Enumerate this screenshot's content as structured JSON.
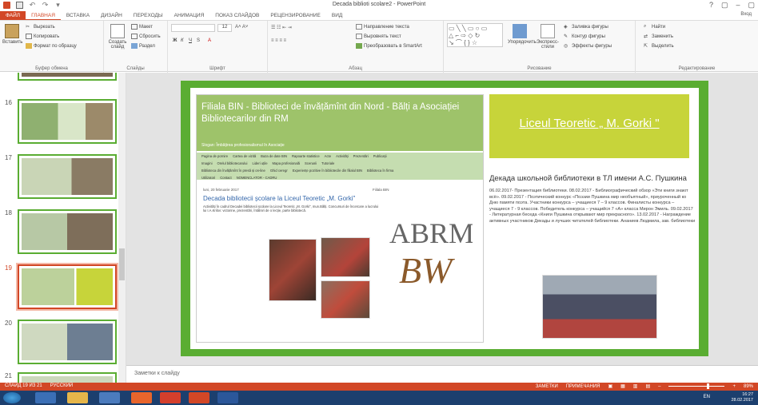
{
  "window": {
    "title": "Decada biblioti scolare2 - PowerPoint",
    "controls": [
      "?",
      "▢",
      "–",
      "▢"
    ]
  },
  "tabs": [
    {
      "label": "ФАЙЛ",
      "kind": "file"
    },
    {
      "label": "ГЛАВНАЯ",
      "kind": "active"
    },
    {
      "label": "ВСТАВКА",
      "kind": ""
    },
    {
      "label": "ДИЗАЙН",
      "kind": ""
    },
    {
      "label": "ПЕРЕХОДЫ",
      "kind": ""
    },
    {
      "label": "АНИМАЦИЯ",
      "kind": ""
    },
    {
      "label": "ПОКАЗ СЛАЙДОВ",
      "kind": ""
    },
    {
      "label": "РЕЦЕНЗИРОВАНИЕ",
      "kind": ""
    },
    {
      "label": "ВИД",
      "kind": ""
    }
  ],
  "signin": "Вход",
  "ribbon": {
    "clipboard": {
      "paste": "Вставить",
      "cut": "Вырезать",
      "copy": "Копировать",
      "format_painter": "Формат по образцу",
      "label": "Буфер обмена"
    },
    "slides": {
      "new_slide": "Создать слайд",
      "layout": "Макет",
      "reset": "Сбросить",
      "section": "Раздел",
      "label": "Слайды"
    },
    "font": {
      "size": "12",
      "bold": "Ж",
      "italic": "К",
      "underline": "Ч",
      "strike": "S",
      "label": "Шрифт"
    },
    "paragraph": {
      "text_direction": "Направление текста",
      "align_text": "Выровнять текст",
      "smartart": "Преобразовать в SmartArt",
      "label": "Абзац"
    },
    "drawing": {
      "arrange": "Упорядочить",
      "quick_styles": "Экспресс-стили",
      "fill": "Заливка фигуры",
      "outline": "Контур фигуры",
      "effects": "Эффекты фигуры",
      "label": "Рисование"
    },
    "editing": {
      "find": "Найти",
      "replace": "Заменить",
      "select": "Выделить",
      "label": "Редактирование"
    }
  },
  "thumbnails": [
    {
      "num": "16",
      "selected": false
    },
    {
      "num": "17",
      "selected": false
    },
    {
      "num": "18",
      "selected": false
    },
    {
      "num": "19",
      "selected": true
    },
    {
      "num": "20",
      "selected": false
    },
    {
      "num": "21",
      "selected": false
    }
  ],
  "slide": {
    "web_title": "Filiala BIN - Biblioteci de învățămînt din Nord - Bălți a Asociației Bibliotecarilor din RM",
    "web_slogan": "Slogan: Îmbățirea profesionalismul în Asociație",
    "nav_row1": [
      "Pagina de pornire",
      "Cartea de vizită",
      "Baza de date BIN",
      "Rapoarte statistice",
      "Acte",
      "Activități",
      "Prezentări",
      "Publicații"
    ],
    "nav_row2": [
      "Imagini",
      "Orelul bibliotecarului",
      "Lideri uțile",
      "Mapa profesională",
      "Scenarii",
      "Tutoriale"
    ],
    "nav_row3": [
      "Biblioteca din învățămînt în presă și on-line",
      "Ghid ceregr",
      "Experiențe pozitive în bibliotecile din filialul BIN",
      "Biblioteca în firma"
    ],
    "nav_row4": [
      "Utilizatori",
      "Contact",
      "NOMENCLATOR - CADRU"
    ],
    "post_date": "luni, 20 februarie 2017",
    "post_cat": "Fiilala BIN",
    "post_title": "Decada bibliotecii școlare la Liceul Teoretic „M. Gorki\"",
    "post_text": "Activități în cadrul Decadei bibliotecii școlare la Liceul Teoretic „M. Gorki\", mun.Bălți. Concursuri de încercare a lucrului lui I.A.Krilov: victorine, prezentări, întâlniri de o lecție, parte bibliotecă.",
    "gorki_title": "Liceul Teoretic „ M. Gorki \"",
    "ru_title": "Декада школьной библиотеки в ТЛ имени А.С. Пушкина",
    "ru_text": "06.02.2017- Презентация библиотеки. 08.02.2017 - Библиографический обзор «Эти книги знают всё». 09.02.2017 - Поэтический конкурс «Поэзии Пушкина мир необъятный», приуроченный ко Дню памяти поэта. Участники конкурса – учащиеся 7 – 9 классов. Финалисты конкурса – учащиеся 7 - 9 классов. Победитель конкурса – учащийся 7 «А» класса Мирон Эмиль. 09.02.2017 - Литературная беседа «Книги Пушкина открывают мир прекрасного». 13.02.2017 - Награждение активных участников Декады и лучших читателей библиотеки. Ананиев Людмила, зав. библиотеки"
  },
  "notes_placeholder": "Заметки к слайду",
  "status": {
    "slide_of": "СЛАЙД 19 ИЗ 21",
    "language": "РУССКИЙ",
    "notes": "ЗАМЕТКИ",
    "comments": "ПРИМЕЧАНИЯ",
    "zoom": "89%"
  },
  "taskbar": {
    "lang": "EN",
    "time": "16:27",
    "date": "28.02.2017"
  },
  "colors": {
    "accent": "#d24726",
    "slide_border": "#5aad32",
    "web_header": "#9ec36a",
    "gorki_box": "#c7d43a",
    "taskbar": "#1c3f6e"
  }
}
